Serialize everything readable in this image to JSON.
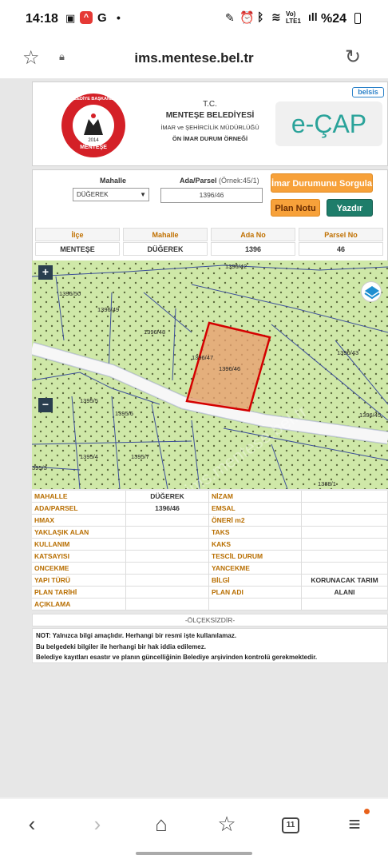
{
  "status_bar": {
    "time": "14:18",
    "network": "Vo) LTE1",
    "battery": "%24"
  },
  "browser": {
    "url": "ims.mentese.bel.tr"
  },
  "header": {
    "logo_ring_top": "BELEDİYE BAŞKANLIĞI",
    "logo_year": "2014",
    "logo_ring_bottom": "MENTEŞE",
    "tc": "T.C.",
    "municipality": "MENTEŞE BELEDİYESİ",
    "department": "İMAR ve ŞEHİRCİLİK MÜDÜRLÜĞÜ",
    "sample_title": "ÖN İMAR DURUM ÖRNEĞİ",
    "vendor_badge": "belsis",
    "brand": "e-ÇAP"
  },
  "query": {
    "mahalle_label": "Mahalle",
    "mahalle_value": "DÜĞEREK",
    "parsel_label": "Ada/Parsel",
    "parsel_example": "(Örnek:45/1)",
    "parsel_value": "1396/46",
    "btn_sorgula": "İmar Durumunu Sorgula",
    "btn_plan": "Plan Notu",
    "btn_yazdir": "Yazdır"
  },
  "info": {
    "headers": [
      "İlçe",
      "Mahalle",
      "Ada No",
      "Parsel No"
    ],
    "values": [
      "MENTEŞE",
      "DÜĞEREK",
      "1396",
      "46"
    ]
  },
  "map": {
    "labels": [
      "1396/42",
      "1396/50",
      "1396/49",
      "1396/48",
      "1396/47",
      "1396/46",
      "1396/43",
      "1396/45",
      "1395/6",
      "1395/5",
      "1395/4",
      "1395/7",
      "395/3",
      "1388/1"
    ],
    "zoom_in": "+",
    "zoom_out": "−",
    "watermark": "ims.mentese.bel.tr"
  },
  "table": {
    "rows": [
      {
        "k1": "MAHALLE",
        "v1": "DÜĞEREK",
        "k2": "NİZAM",
        "v2": ""
      },
      {
        "k1": "ADA/PARSEL",
        "v1": "1396/46",
        "k2": "EMSAL",
        "v2": ""
      },
      {
        "k1": "HMAX",
        "v1": "",
        "k2": "ÖNERİ m2",
        "v2": ""
      },
      {
        "k1": "YAKLAŞIK ALAN",
        "v1": "",
        "k2": "TAKS",
        "v2": ""
      },
      {
        "k1": "KULLANIM",
        "v1": "",
        "k2": "KAKS",
        "v2": ""
      },
      {
        "k1": "KATSAYISI",
        "v1": "",
        "k2": "TESCİL DURUM",
        "v2": ""
      },
      {
        "k1": "ONCEKME",
        "v1": "",
        "k2": "YANCEKME",
        "v2": ""
      },
      {
        "k1": "YAPI TÜRÜ",
        "v1": "",
        "k2": "BİLGİ",
        "v2": "KORUNACAK TARIM ALANI"
      },
      {
        "k1": "PLAN TARİHİ",
        "v1": "",
        "k2": "PLAN ADI",
        "v2": ""
      },
      {
        "k1": "AÇIKLAMA",
        "v1": "",
        "k2": "",
        "v2": ""
      }
    ],
    "scale_note": "-ÖLÇEKSİZDİR-"
  },
  "notes": [
    "NOT: Yalnızca bilgi amaçlıdır. Herhangi bir resmi işte kullanılamaz.",
    "Bu belgedeki bilgiler ile herhangi bir hak iddia edilemez.",
    "Belediye kayıtları esastır ve planın güncelliğinin Belediye arşivinden kontrolü gerekmektedir."
  ],
  "nav": {
    "tabs_count": "11"
  },
  "colors": {
    "accent_orange": "#f7a13a",
    "accent_green": "#1e7d6a",
    "parcel_fill": "#e8a070",
    "parcel_stroke": "#d40000",
    "map_bg": "#cfe8a8",
    "logo_red": "#d42027",
    "key_text": "#b86e00"
  }
}
